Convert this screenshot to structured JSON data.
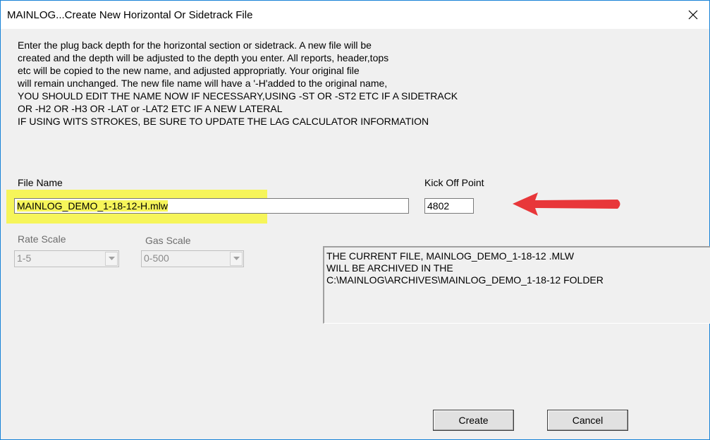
{
  "window": {
    "title": "MAINLOG...Create New Horizontal Or Sidetrack File",
    "close_icon": "close-icon"
  },
  "instructions": [
    "Enter the plug back depth for the horizontal section or sidetrack. A new file will be",
    "created and the depth will be adjusted to the depth you enter. All reports, header,tops",
    "etc will be copied to the new name, and adjusted appropriatly. Your original file",
    "will remain unchanged. The new file name will have a '-H'added to the original name,",
    "YOU SHOULD EDIT THE NAME NOW IF NECESSARY,USING -ST OR -ST2 ETC IF A SIDETRACK",
    "OR -H2 OR -H3 OR -LAT or -LAT2 ETC IF A NEW LATERAL",
    "IF USING WITS STROKES, BE SURE TO UPDATE THE LAG CALCULATOR INFORMATION"
  ],
  "file_name": {
    "label": "File Name",
    "value": "MAINLOG_DEMO_1-18-12-H.mlw"
  },
  "kick_off_point": {
    "label": "Kick Off Point",
    "value": "4802"
  },
  "rate_scale": {
    "label": "Rate Scale",
    "value": "1-5"
  },
  "gas_scale": {
    "label": "Gas Scale",
    "value": "0-500"
  },
  "archive_message": [
    "THE CURRENT FILE, MAINLOG_DEMO_1-18-12 .MLW",
    "WILL BE ARCHIVED IN THE",
    "C:\\MAINLOG\\ARCHIVES\\MAINLOG_DEMO_1-18-12 FOLDER"
  ],
  "buttons": {
    "create": "Create",
    "cancel": "Cancel"
  },
  "colors": {
    "highlight": "#f6f55a",
    "annotation_arrow": "#e8373a",
    "window_border": "#1883d7"
  }
}
